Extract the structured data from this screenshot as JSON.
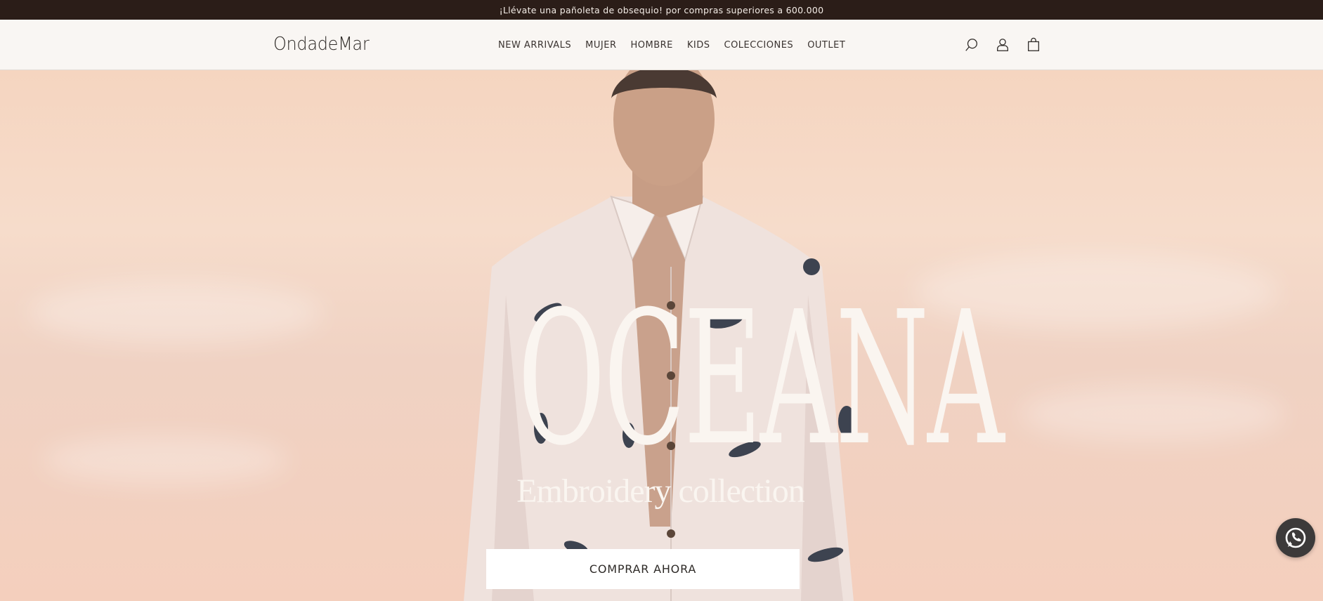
{
  "announcement": {
    "text": "¡Llévate una pañoleta de obsequio! por compras superiores a 600.000"
  },
  "header": {
    "logo": "OndadeMar",
    "nav": [
      "NEW ARRIVALS",
      "MUJER",
      "HOMBRE",
      "KIDS",
      "COLECCIONES",
      "OUTLET"
    ],
    "icons": [
      "search-icon",
      "account-icon",
      "cart-icon"
    ]
  },
  "hero": {
    "title": "OCEANA",
    "subtitle": "Embroidery collection",
    "cta_label": "COMPRAR AHORA"
  },
  "floating": {
    "icon": "whatsapp-icon"
  },
  "colors": {
    "announcement_bg": "#2b1d18",
    "header_bg": "#f9f6f3",
    "hero_text": "#faf5f0",
    "cta_bg": "#ffffff"
  }
}
